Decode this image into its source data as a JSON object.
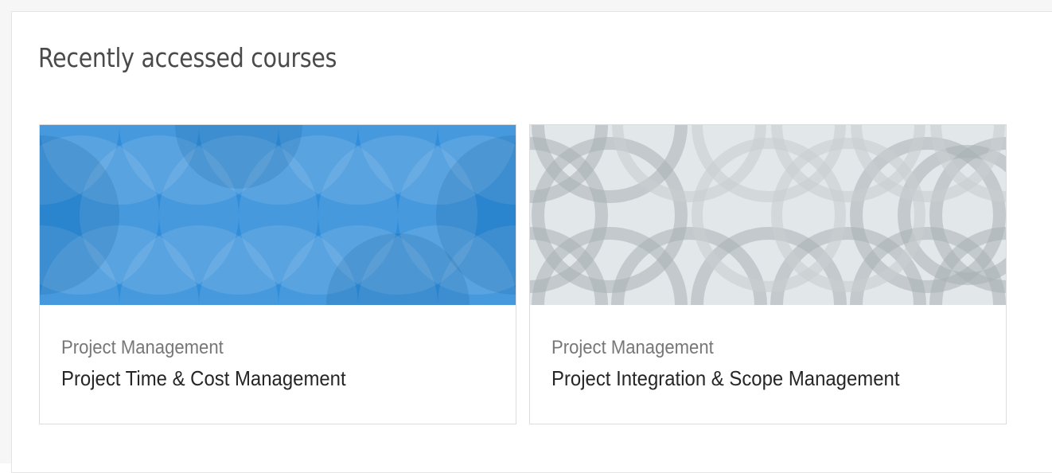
{
  "block": {
    "title": "Recently accessed courses"
  },
  "courses": [
    {
      "category": "Project Management",
      "name": "Project Time & Cost Management",
      "pattern": "blue-circles-pattern",
      "colors": {
        "base": "#1a82d6",
        "light": "#3f9be0",
        "dark": "#0f6cb8"
      }
    },
    {
      "category": "Project Management",
      "name": "Project Integration & Scope Management",
      "pattern": "grey-rings-pattern",
      "colors": {
        "base": "#e2e7ea",
        "ring": "#aab0b4",
        "ring_light": "#c9ced1"
      }
    }
  ]
}
